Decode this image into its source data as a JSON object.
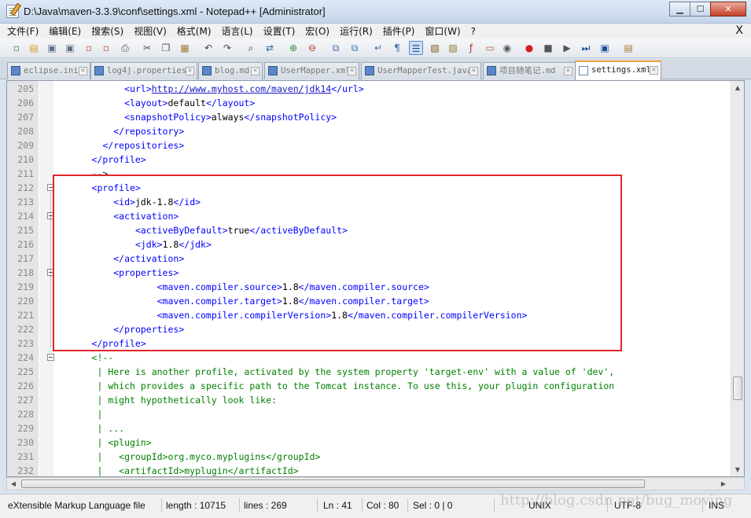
{
  "window": {
    "title": "D:\\Java\\maven-3.3.9\\conf\\settings.xml - Notepad++ [Administrator]",
    "minimize_label": "▁",
    "maximize_label": "☐",
    "close_label": "✕"
  },
  "menu": {
    "items": [
      {
        "label": "文件(F)"
      },
      {
        "label": "编辑(E)"
      },
      {
        "label": "搜索(S)"
      },
      {
        "label": "视图(V)"
      },
      {
        "label": "格式(M)"
      },
      {
        "label": "语言(L)"
      },
      {
        "label": "设置(T)"
      },
      {
        "label": "宏(O)"
      },
      {
        "label": "运行(R)"
      },
      {
        "label": "插件(P)"
      },
      {
        "label": "窗口(W)"
      },
      {
        "label": "?"
      }
    ],
    "close_doc_label": "X"
  },
  "toolbar": {
    "buttons": [
      {
        "icon": "new-file-icon",
        "glyph": "▫",
        "color": "#4a8c3a"
      },
      {
        "icon": "open-file-icon",
        "glyph": "▤",
        "color": "#d99a22"
      },
      {
        "icon": "save-icon",
        "glyph": "▣",
        "color": "#5d6f88"
      },
      {
        "icon": "save-all-icon",
        "glyph": "▣",
        "color": "#5d6f88"
      },
      {
        "icon": "close-file-icon",
        "glyph": "▫",
        "color": "#c94b2c"
      },
      {
        "icon": "close-all-icon",
        "glyph": "▫",
        "color": "#c94b2c"
      },
      {
        "icon": "print-icon",
        "glyph": "⎙",
        "color": "#555"
      },
      {
        "icon": "cut-icon",
        "glyph": "✂",
        "color": "#555"
      },
      {
        "icon": "copy-icon",
        "glyph": "❐",
        "color": "#555"
      },
      {
        "icon": "paste-icon",
        "glyph": "▦",
        "color": "#a57a32"
      },
      {
        "icon": "undo-icon",
        "glyph": "↶",
        "color": "#444"
      },
      {
        "icon": "redo-icon",
        "glyph": "↷",
        "color": "#444"
      },
      {
        "icon": "find-icon",
        "glyph": "⌕",
        "color": "#333"
      },
      {
        "icon": "replace-icon",
        "glyph": "⇄",
        "color": "#2d69b3"
      },
      {
        "icon": "zoom-in-icon",
        "glyph": "⊕",
        "color": "#2f8a3a"
      },
      {
        "icon": "zoom-out-icon",
        "glyph": "⊖",
        "color": "#b3372d"
      },
      {
        "icon": "sync-vertical-icon",
        "glyph": "⧉",
        "color": "#3a6fb0"
      },
      {
        "icon": "sync-horizontal-icon",
        "glyph": "⧉",
        "color": "#3a6fb0"
      },
      {
        "icon": "word-wrap-icon",
        "glyph": "↵",
        "color": "#3a6fb0"
      },
      {
        "icon": "show-all-chars-icon",
        "glyph": "¶",
        "color": "#3a6fb0"
      },
      {
        "icon": "indent-guide-icon",
        "glyph": "☰",
        "color": "#1b4f9c"
      },
      {
        "icon": "udl-icon",
        "glyph": "▧",
        "color": "#7a5a12"
      },
      {
        "icon": "document-map-icon",
        "glyph": "▨",
        "color": "#8a7a22"
      },
      {
        "icon": "function-list-icon",
        "glyph": "ƒ",
        "color": "#b3372d"
      },
      {
        "icon": "folder-as-workspace-icon",
        "glyph": "▭",
        "color": "#c65d3a"
      },
      {
        "icon": "monitor-icon",
        "glyph": "◉",
        "color": "#555"
      },
      {
        "icon": "record-macro-icon",
        "glyph": "●",
        "color": "#d21f1f"
      },
      {
        "icon": "stop-macro-icon",
        "glyph": "■",
        "color": "#555"
      },
      {
        "icon": "play-macro-icon",
        "glyph": "▶",
        "color": "#555"
      },
      {
        "icon": "run-macro-multiple-icon",
        "glyph": "⏭",
        "color": "#1b4f9c"
      },
      {
        "icon": "save-macro-icon",
        "glyph": "▣",
        "color": "#1b4f9c"
      },
      {
        "icon": "plugin-icon",
        "glyph": "▤",
        "color": "#a57a32"
      }
    ]
  },
  "tabs": [
    {
      "label": "eclipse.ini",
      "active": false
    },
    {
      "label": "log4j.properties",
      "active": false
    },
    {
      "label": "blog.md",
      "active": false
    },
    {
      "label": "UserMapper.xml",
      "active": false
    },
    {
      "label": "UserMapperTest.java",
      "active": false
    },
    {
      "label": "项目随笔记.md",
      "active": false
    },
    {
      "label": "settings.xml",
      "active": true
    }
  ],
  "editor": {
    "lines": [
      {
        "num": "205",
        "indent": "            ",
        "parts": [
          [
            "tag",
            "<url>"
          ],
          [
            "url",
            "http://www.myhost.com/maven/jdk14"
          ],
          [
            "tag",
            "</url>"
          ]
        ]
      },
      {
        "num": "206",
        "indent": "            ",
        "parts": [
          [
            "tag",
            "<layout>"
          ],
          [
            "txt",
            "default"
          ],
          [
            "tag",
            "</layout>"
          ]
        ]
      },
      {
        "num": "207",
        "indent": "            ",
        "parts": [
          [
            "tag",
            "<snapshotPolicy>"
          ],
          [
            "txt",
            "always"
          ],
          [
            "tag",
            "</snapshotPolicy>"
          ]
        ]
      },
      {
        "num": "208",
        "indent": "          ",
        "parts": [
          [
            "tag",
            "</repository>"
          ]
        ]
      },
      {
        "num": "209",
        "indent": "        ",
        "parts": [
          [
            "tag",
            "</repositories>"
          ]
        ]
      },
      {
        "num": "210",
        "indent": "      ",
        "parts": [
          [
            "tag",
            "</profile>"
          ]
        ]
      },
      {
        "num": "211",
        "indent": "      ",
        "parts": [
          [
            "txt",
            "-->"
          ]
        ]
      },
      {
        "num": "212",
        "indent": "      ",
        "parts": [
          [
            "tag",
            "<profile>"
          ]
        ]
      },
      {
        "num": "213",
        "indent": "          ",
        "parts": [
          [
            "tag",
            "<id>"
          ],
          [
            "txt",
            "jdk-1.8"
          ],
          [
            "tag",
            "</id>"
          ]
        ]
      },
      {
        "num": "214",
        "indent": "          ",
        "parts": [
          [
            "tag",
            "<activation>"
          ]
        ]
      },
      {
        "num": "215",
        "indent": "              ",
        "parts": [
          [
            "tag",
            "<activeByDefault>"
          ],
          [
            "txt",
            "true"
          ],
          [
            "tag",
            "</activeByDefault>"
          ]
        ]
      },
      {
        "num": "216",
        "indent": "              ",
        "parts": [
          [
            "tag",
            "<jdk>"
          ],
          [
            "txt",
            "1.8"
          ],
          [
            "tag",
            "</jdk>"
          ]
        ]
      },
      {
        "num": "217",
        "indent": "          ",
        "parts": [
          [
            "tag",
            "</activation>"
          ]
        ]
      },
      {
        "num": "218",
        "indent": "          ",
        "parts": [
          [
            "tag",
            "<properties>"
          ]
        ]
      },
      {
        "num": "219",
        "indent": "                  ",
        "parts": [
          [
            "tag",
            "<maven.compiler.source>"
          ],
          [
            "txt",
            "1.8"
          ],
          [
            "tag",
            "</maven.compiler.source>"
          ]
        ]
      },
      {
        "num": "220",
        "indent": "                  ",
        "parts": [
          [
            "tag",
            "<maven.compiler.target>"
          ],
          [
            "txt",
            "1.8"
          ],
          [
            "tag",
            "</maven.compiler.target>"
          ]
        ]
      },
      {
        "num": "221",
        "indent": "                  ",
        "parts": [
          [
            "tag",
            "<maven.compiler.compilerVersion>"
          ],
          [
            "txt",
            "1.8"
          ],
          [
            "tag",
            "</maven.compiler.compilerVersion>"
          ]
        ]
      },
      {
        "num": "222",
        "indent": "          ",
        "parts": [
          [
            "tag",
            "</properties>"
          ]
        ]
      },
      {
        "num": "223",
        "indent": "      ",
        "parts": [
          [
            "tag",
            "</profile>"
          ]
        ]
      },
      {
        "num": "224",
        "indent": "      ",
        "parts": [
          [
            "cmt",
            "<!--"
          ]
        ]
      },
      {
        "num": "225",
        "indent": "       ",
        "parts": [
          [
            "cmt",
            "| Here is another profile, activated by the system property 'target-env' with a value of 'dev',"
          ]
        ]
      },
      {
        "num": "226",
        "indent": "       ",
        "parts": [
          [
            "cmt",
            "| which provides a specific path to the Tomcat instance. To use this, your plugin configuration"
          ]
        ]
      },
      {
        "num": "227",
        "indent": "       ",
        "parts": [
          [
            "cmt",
            "| might hypothetically look like:"
          ]
        ]
      },
      {
        "num": "228",
        "indent": "       ",
        "parts": [
          [
            "cmt",
            "|"
          ]
        ]
      },
      {
        "num": "229",
        "indent": "       ",
        "parts": [
          [
            "cmt",
            "| ..."
          ]
        ]
      },
      {
        "num": "230",
        "indent": "       ",
        "parts": [
          [
            "cmt",
            "| <plugin>"
          ]
        ]
      },
      {
        "num": "231",
        "indent": "       ",
        "parts": [
          [
            "cmt",
            "|   <groupId>org.myco.myplugins</groupId>"
          ]
        ]
      },
      {
        "num": "232",
        "indent": "       ",
        "parts": [
          [
            "cmt",
            "|   <artifactId>myplugin</artifactId>"
          ]
        ]
      }
    ],
    "fold_markers": [
      "212",
      "214",
      "218",
      "224"
    ]
  },
  "status": {
    "file_type": "eXtensible Markup Language file",
    "length": "length : 10715",
    "lines": "lines : 269",
    "ln": "Ln : 41",
    "col": "Col : 80",
    "sel": "Sel : 0 | 0",
    "eol": "UNIX",
    "encoding": "UTF-8",
    "mode": "INS"
  },
  "watermark": "http://blog.csdn.net/bug_moving"
}
